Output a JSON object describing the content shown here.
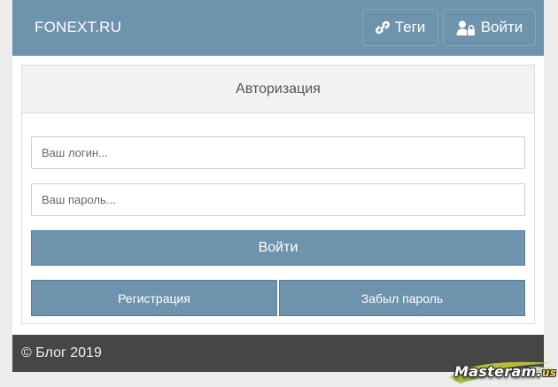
{
  "header": {
    "brand": "FONEXT.RU",
    "nav": {
      "tags_label": "Теги",
      "login_label": "Войти"
    },
    "icons": {
      "tags": "link-icon",
      "login": "user-lock-icon"
    }
  },
  "auth_panel": {
    "title": "Авторизация",
    "login_placeholder": "Ваш логин...",
    "login_value": "",
    "password_placeholder": "Ваш пароль...",
    "password_value": "",
    "submit_label": "Войти",
    "register_label": "Регистрация",
    "forgot_label": "Забыл пароль"
  },
  "footer": {
    "copyright": "© Блог 2019"
  },
  "watermark": {
    "text": "Masteram.",
    "suffix": "us"
  },
  "colors": {
    "primary": "#6e93ad",
    "footer_bg": "#464646",
    "panel_header_bg": "#f2f2f2",
    "page_bg": "#ececec"
  }
}
